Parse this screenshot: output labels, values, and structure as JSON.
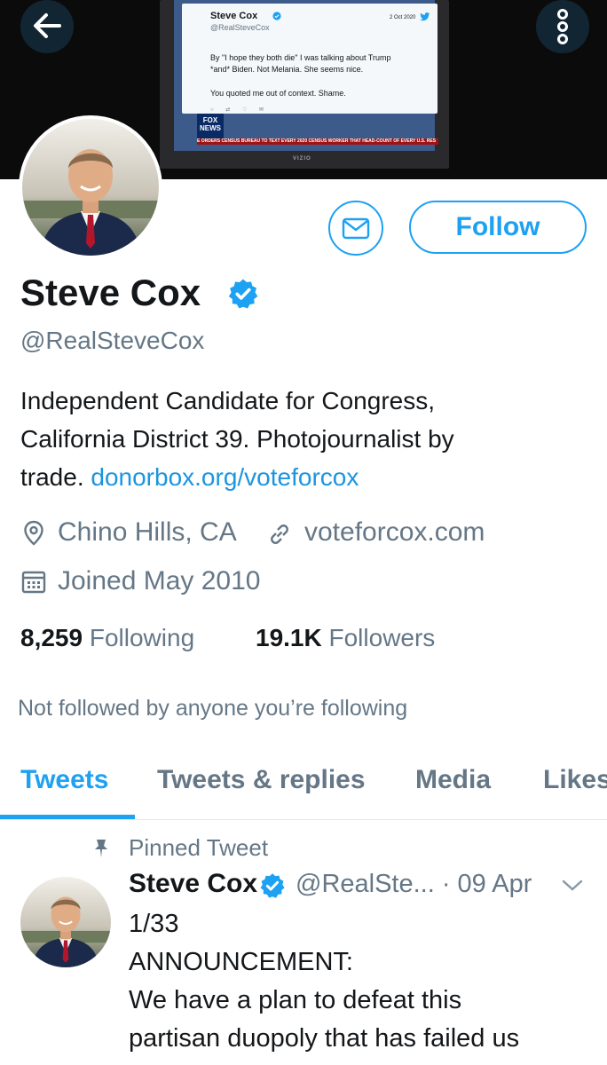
{
  "banner": {
    "embedded_tweet": {
      "name": "Steve Cox",
      "handle": "@RealSteveCox",
      "date": "2 Oct 2020",
      "lines": [
        "By \"I hope they both die\" I was talking about Trump",
        "*and* Biden. Not Melania. She seems nice.",
        "You quoted me out of context. Shame."
      ]
    },
    "fox_logo_line1": "FOX",
    "fox_logo_line2": "NEWS",
    "ticker": "E ORDERS CENSUS BUREAU TO TEXT EVERY 2020 CENSUS WORKER THAT HEAD-COUNT OF EVERY U.S. RES",
    "tv_brand": "VIZIO"
  },
  "profile": {
    "name": "Steve Cox",
    "handle": "@RealSteveCox",
    "bio_lines": [
      "Independent Candidate for Congress,",
      "California District 39. Photojournalist by"
    ],
    "bio_last_text": "trade.",
    "bio_link": "donorbox.org/voteforcox",
    "location": "Chino Hills, CA",
    "website": "voteforcox.com",
    "joined": "Joined May 2010",
    "following_count": "8,259",
    "following_label": "Following",
    "followers_count": "19.1K",
    "followers_label": "Followers",
    "not_followed": "Not followed by anyone you’re following",
    "follow_label": "Follow"
  },
  "tabs": [
    {
      "label": "Tweets",
      "active": true
    },
    {
      "label": "Tweets & replies",
      "active": false
    },
    {
      "label": "Media",
      "active": false
    },
    {
      "label": "Likes",
      "active": false
    }
  ],
  "pinned_tweet": {
    "pinned_label": "Pinned Tweet",
    "name": "Steve Cox",
    "handle_date": "@RealSte... · 09 Apr",
    "lines": [
      "1/33",
      "ANNOUNCEMENT:",
      "We have a plan to defeat this",
      "partisan duopoly that has failed us"
    ]
  },
  "colors": {
    "accent": "#1da1f2",
    "link": "#1b95e0",
    "secondary_text": "#657786"
  }
}
